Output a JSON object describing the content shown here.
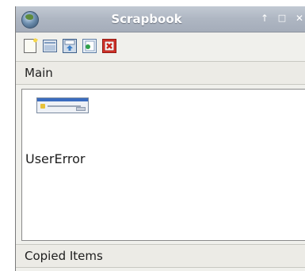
{
  "window": {
    "title": "Scrapbook",
    "controls": {
      "pin": "↑",
      "maximize": "□",
      "close": "✕"
    }
  },
  "toolbar": {
    "tools": [
      {
        "icon": "new-document-icon"
      },
      {
        "icon": "folder-icon"
      },
      {
        "icon": "save-icon"
      },
      {
        "icon": "paste-icon"
      },
      {
        "icon": "delete-icon"
      }
    ]
  },
  "main": {
    "header": "Main",
    "items": [
      {
        "label": "UserError",
        "thumbnail": "error-dialog-thumbnail"
      }
    ]
  },
  "copied": {
    "header": "Copied Items"
  },
  "colors": {
    "titlebar": "#aeb6c2",
    "background": "#f0f0ec",
    "delete": "#d9342b"
  }
}
